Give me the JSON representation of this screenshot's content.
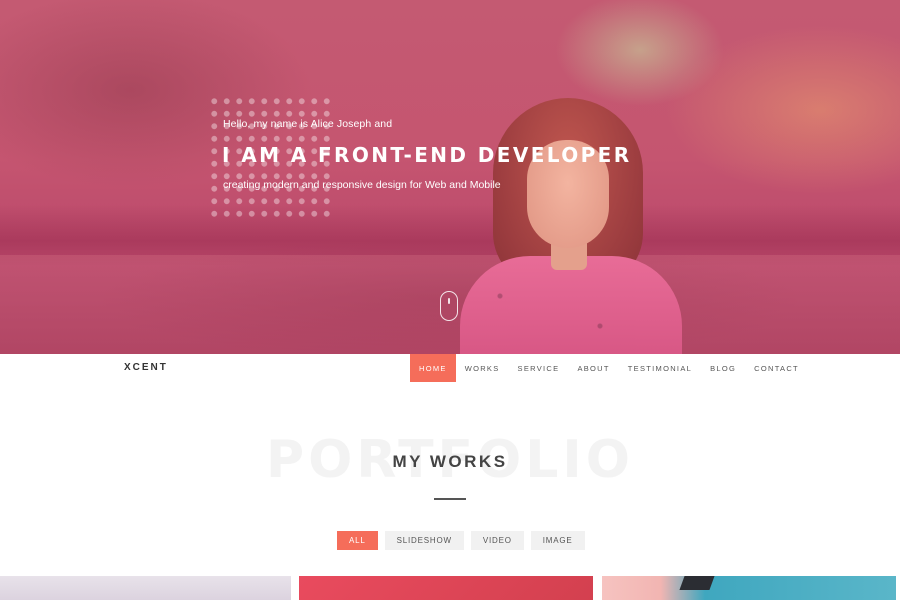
{
  "hero": {
    "greeting": "Hello, my name is Alice Joseph and",
    "title": "I AM A FRONT-END DEVELOPER",
    "subtitle": "creating modern and responsive design for Web and Mobile",
    "scroll_icon": "mouse-scroll-icon"
  },
  "navbar": {
    "brand": "XCENT",
    "items": [
      {
        "label": "HOME",
        "active": true
      },
      {
        "label": "WORKS",
        "active": false
      },
      {
        "label": "SERVICE",
        "active": false
      },
      {
        "label": "ABOUT",
        "active": false
      },
      {
        "label": "TESTIMONIAL",
        "active": false
      },
      {
        "label": "BLOG",
        "active": false
      },
      {
        "label": "CONTACT",
        "active": false
      }
    ]
  },
  "portfolio": {
    "background_word": "PORTFOLIO",
    "title": "MY WORKS",
    "filters": [
      {
        "label": "ALL",
        "active": true
      },
      {
        "label": "SLIDESHOW",
        "active": false
      },
      {
        "label": "VIDEO",
        "active": false
      },
      {
        "label": "IMAGE",
        "active": false
      }
    ]
  },
  "colors": {
    "accent": "#f56d5a",
    "hero_overlay": "#c45a72"
  }
}
